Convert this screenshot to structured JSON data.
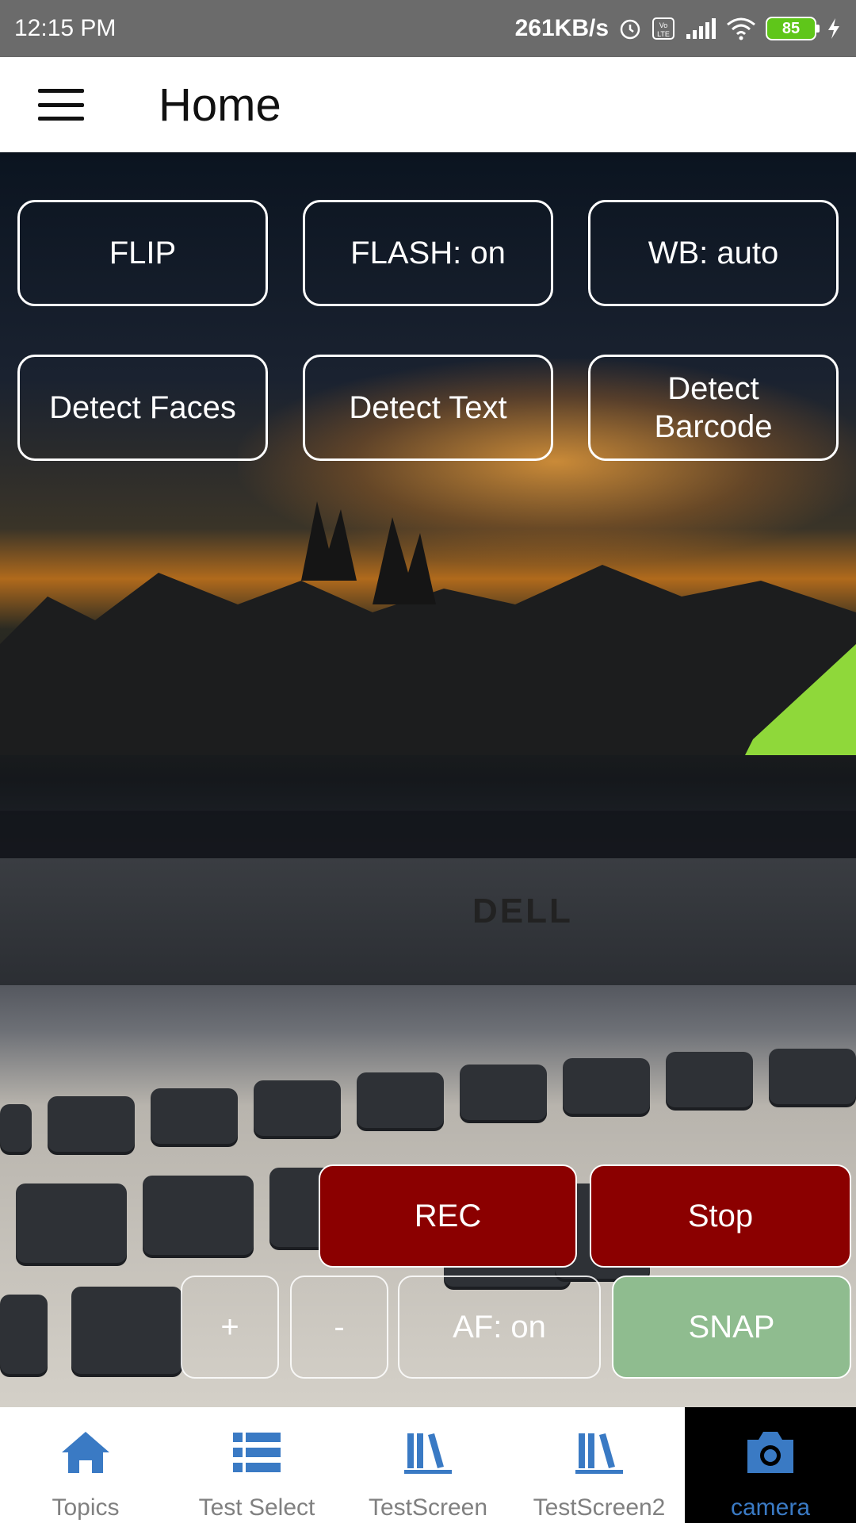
{
  "status_bar": {
    "time": "12:15 PM",
    "net_speed": "261KB/s",
    "battery": "85",
    "icons": [
      "alarm-icon",
      "volte-icon",
      "signal-icon",
      "wifi-icon",
      "battery-icon",
      "charging-icon"
    ]
  },
  "app_bar": {
    "title": "Home",
    "menu_icon": "hamburger-menu-icon"
  },
  "camera_controls": {
    "flip": "FLIP",
    "flash": "FLASH: on",
    "wb": "WB: auto",
    "detect_faces": "Detect Faces",
    "detect_text": "Detect Text",
    "detect_barcode": "Detect Barcode",
    "rec": "REC",
    "stop": "Stop",
    "zoom_in": "+",
    "zoom_out": "-",
    "af": "AF: on",
    "snap": "SNAP"
  },
  "bottom_nav": {
    "items": [
      {
        "label": "Topics",
        "icon": "home-icon"
      },
      {
        "label": "Test Select",
        "icon": "list-icon"
      },
      {
        "label": "TestScreen",
        "icon": "library-icon"
      },
      {
        "label": "TestScreen2",
        "icon": "library-icon"
      },
      {
        "label": "camera",
        "icon": "camera-icon"
      }
    ],
    "active_index": 4
  },
  "colors": {
    "rec_button": "#8b0000",
    "snap_button": "#8fbc8f",
    "nav_active": "#3a7ac4",
    "status_bar": "#6b6b6b"
  }
}
